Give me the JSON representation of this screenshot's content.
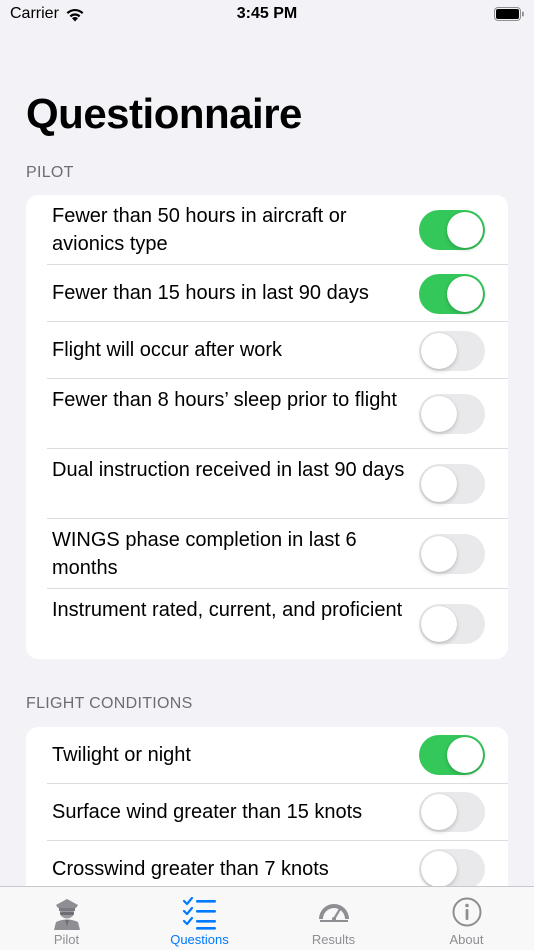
{
  "status_bar": {
    "carrier": "Carrier",
    "time": "3:45 PM"
  },
  "page_title": "Questionnaire",
  "sections": [
    {
      "header": "PILOT",
      "items": [
        {
          "label": "Fewer than 50 hours in aircraft or avionics type",
          "on": true
        },
        {
          "label": "Fewer than 15 hours in last 90 days",
          "on": true
        },
        {
          "label": "Flight will occur after work",
          "on": false
        },
        {
          "label": "Fewer than 8 hours’ sleep prior to flight",
          "on": false
        },
        {
          "label": "Dual instruction received in last 90 days",
          "on": false
        },
        {
          "label": "WINGS phase completion in last 6 months",
          "on": false
        },
        {
          "label": "Instrument rated, current, and proficient",
          "on": false
        }
      ]
    },
    {
      "header": "FLIGHT CONDITIONS",
      "items": [
        {
          "label": "Twilight or night",
          "on": true
        },
        {
          "label": "Surface wind greater than 15 knots",
          "on": false
        },
        {
          "label": "Crosswind greater than 7 knots",
          "on": false
        }
      ]
    }
  ],
  "tabs": [
    {
      "label": "Pilot",
      "icon": "pilot-icon",
      "active": false
    },
    {
      "label": "Questions",
      "icon": "checklist-icon",
      "active": true
    },
    {
      "label": "Results",
      "icon": "gauge-icon",
      "active": false
    },
    {
      "label": "About",
      "icon": "info-icon",
      "active": false
    }
  ],
  "colors": {
    "toggle_on": "#34c759",
    "accent": "#007aff",
    "background": "#f2f2f7"
  }
}
